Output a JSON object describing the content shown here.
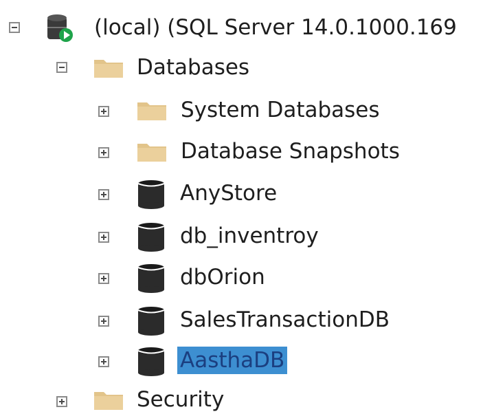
{
  "tree": {
    "server": {
      "label": "(local) (SQL Server 14.0.1000.169",
      "expanded": true,
      "icon": "server-running-icon"
    },
    "databases": {
      "label": "Databases",
      "expanded": true,
      "icon": "folder-icon"
    },
    "children": [
      {
        "label": "System Databases",
        "icon": "folder-icon",
        "expanded": false
      },
      {
        "label": "Database Snapshots",
        "icon": "folder-icon",
        "expanded": false
      },
      {
        "label": "AnyStore",
        "icon": "database-icon",
        "expanded": false
      },
      {
        "label": "db_inventroy",
        "icon": "database-icon",
        "expanded": false
      },
      {
        "label": "dbOrion",
        "icon": "database-icon",
        "expanded": false
      },
      {
        "label": "SalesTransactionDB",
        "icon": "database-icon",
        "expanded": false
      },
      {
        "label": "AasthaDB",
        "icon": "database-icon",
        "expanded": false,
        "selected": true
      }
    ],
    "security": {
      "label": "Security",
      "expanded": false,
      "icon": "folder-icon"
    }
  },
  "colors": {
    "selection": "#3d8fd1",
    "folder": "#e2c48a",
    "database": "#2b2b2b"
  }
}
